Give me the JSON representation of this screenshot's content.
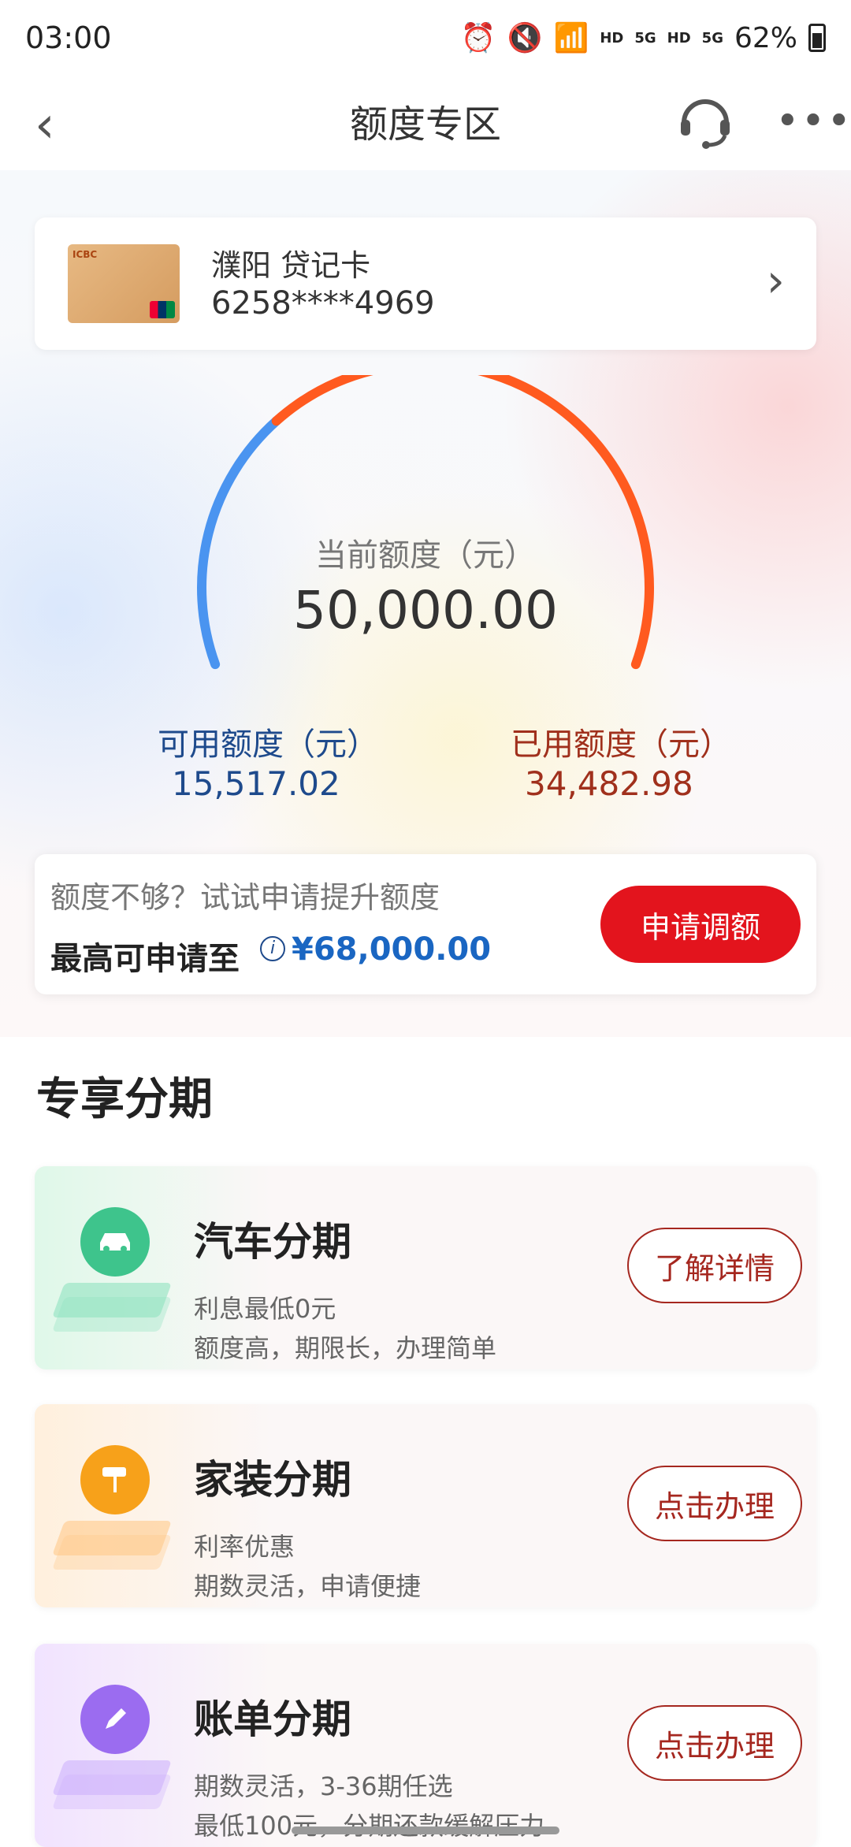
{
  "status_bar": {
    "time": "03:00",
    "hd1": "HD",
    "net1": "5G",
    "hd2": "HD",
    "net2": "5G",
    "battery": "62%"
  },
  "header": {
    "title": "额度专区"
  },
  "card": {
    "name": "濮阳 贷记卡",
    "number": "6258****4969"
  },
  "limit": {
    "current_label": "当前额度（元）",
    "current_value": "50,000.00",
    "available_label": "可用额度（元）",
    "available_value": "15,517.02",
    "used_label": "已用额度（元）",
    "used_value": "34,482.98",
    "available_fraction": 0.31
  },
  "raise": {
    "hint": "额度不够？试试申请提升额度",
    "max_label": "最高可申请至",
    "max_value": "¥68,000.00",
    "button": "申请调额"
  },
  "section": {
    "title": "专享分期"
  },
  "promos": [
    {
      "title": "汽车分期",
      "line1": "利息最低0元",
      "line2": "额度高，期限长，办理简单",
      "button": "了解详情",
      "icon": "car-icon",
      "color": "#3ec48c"
    },
    {
      "title": "家装分期",
      "line1": "利率优惠",
      "line2": "期数灵活，申请便捷",
      "button": "点击办理",
      "icon": "paint-roller-icon",
      "color": "#f7a11a"
    },
    {
      "title": "账单分期",
      "line1": "期数灵活，3-36期任选",
      "line2": "最低100元，分期还款缓解压力",
      "button": "点击办理",
      "icon": "pencil-icon",
      "color": "#9b6cf0"
    }
  ],
  "colors": {
    "available": "#4a94f0",
    "used": "#ff5a1f",
    "brand_red": "#e3141d"
  }
}
